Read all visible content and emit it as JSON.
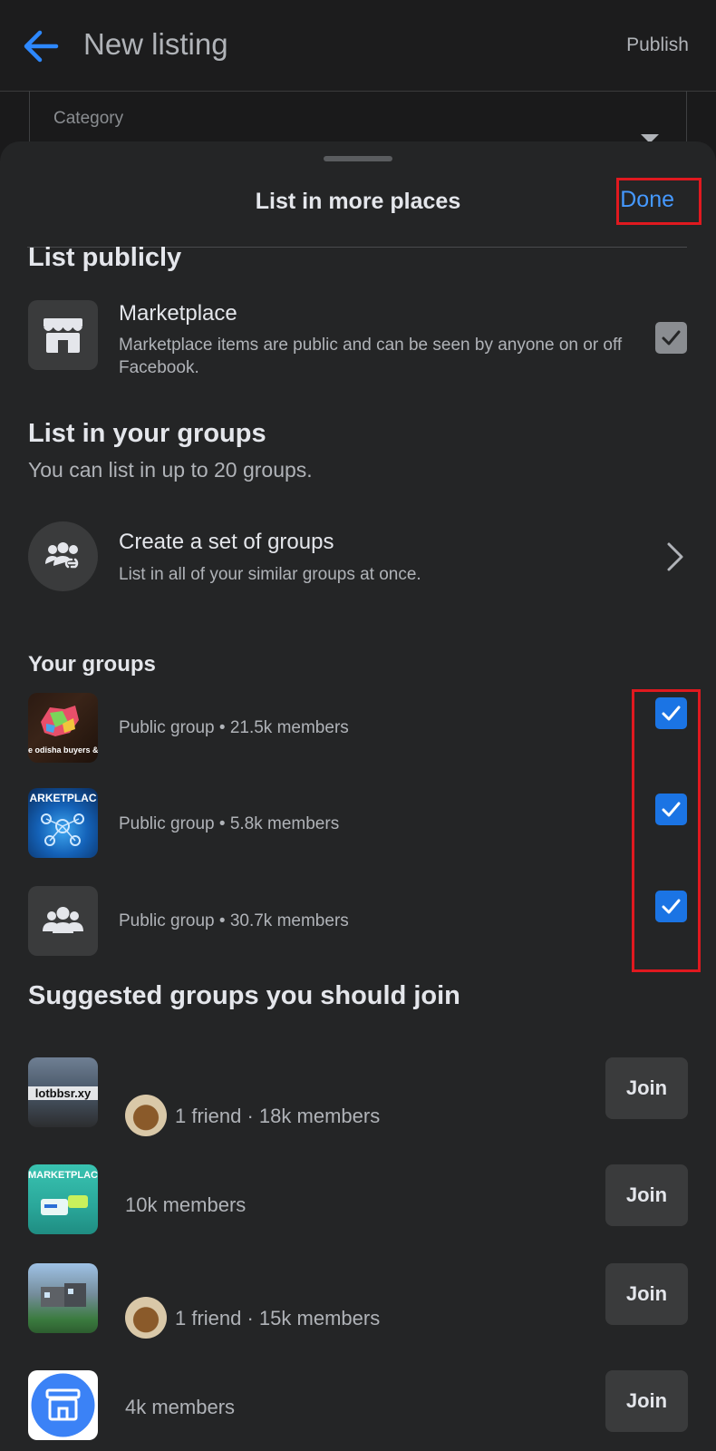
{
  "appbar": {
    "title": "New listing",
    "publish_label": "Publish",
    "category_label": "Category"
  },
  "sheet": {
    "title": "List in more places",
    "done_label": "Done"
  },
  "list_publicly": {
    "heading": "List publicly",
    "marketplace": {
      "title": "Marketplace",
      "description": "Marketplace items are public and can be seen by anyone on or off Facebook.",
      "checked": true
    }
  },
  "list_in_groups": {
    "heading": "List in your groups",
    "subheading": "You can list in up to 20 groups.",
    "create_set": {
      "title": "Create a set of groups",
      "description": "List in all of your similar groups at once."
    }
  },
  "your_groups": {
    "heading": "Your groups",
    "items": [
      {
        "meta": "Public group • 21.5k members",
        "image_text": "e odisha buyers & sellers",
        "checked": true
      },
      {
        "meta": "Public group • 5.8k members",
        "image_text": "ARKETPLAC",
        "checked": true
      },
      {
        "meta": "Public group • 30.7k members",
        "checked": true
      }
    ]
  },
  "suggested": {
    "heading": "Suggested groups you should join",
    "join_label": "Join",
    "items": [
      {
        "meta": "1 friend · 18k members",
        "image_text": "lotbbsr.xy"
      },
      {
        "meta": "10k members",
        "image_text": "MARKETPLAC"
      },
      {
        "meta": "1 friend · 15k members"
      },
      {
        "meta": "4k members"
      }
    ]
  },
  "colors": {
    "accent": "#1b74e4",
    "link": "#4599ff",
    "highlight": "#e0191f"
  }
}
